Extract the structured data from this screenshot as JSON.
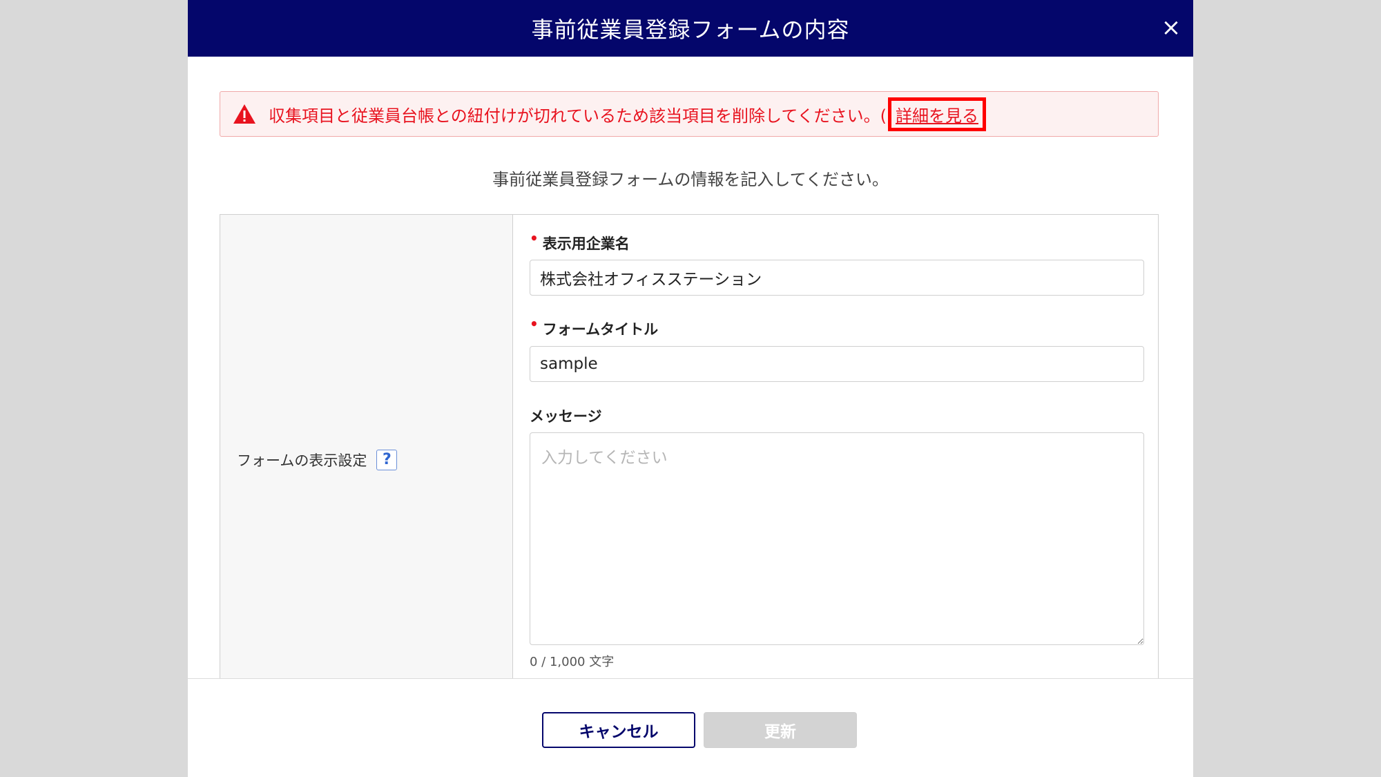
{
  "header": {
    "title": "事前従業員登録フォームの内容",
    "close_label": "×"
  },
  "alert": {
    "message": "収集項目と従業員台帳との紐付けが切れているため該当項目を削除してください。(",
    "link_text": "詳細を見る"
  },
  "intro": "事前従業員登録フォームの情報を記入してください。",
  "form": {
    "section_label": "フォームの表示設定",
    "help_label": "?",
    "company_name": {
      "required_mark": "•",
      "label": "表示用企業名",
      "value": "株式会社オフィスステーション"
    },
    "form_title": {
      "required_mark": "•",
      "label": "フォームタイトル",
      "value": "sample"
    },
    "message": {
      "label": "メッセージ",
      "placeholder": "入力してください",
      "counter": "0 / 1,000 文字"
    }
  },
  "footer": {
    "cancel_label": "キャンセル",
    "update_label": "更新"
  },
  "colors": {
    "header_bg": "#04066b",
    "alert_text": "#e8131f",
    "alert_bg": "#fdf1f1"
  }
}
